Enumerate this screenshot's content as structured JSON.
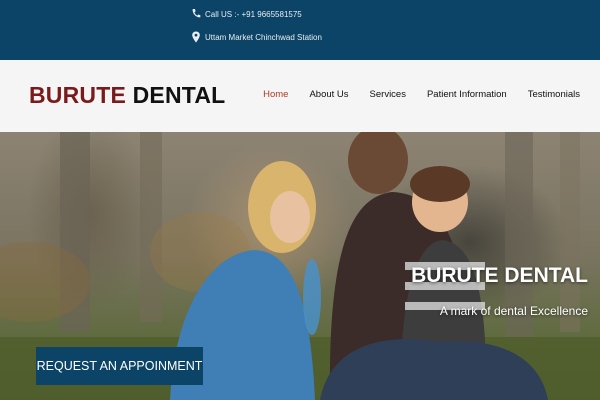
{
  "topbar": {
    "phone_text": "Call US :- +91 9665581575",
    "address_text": "Uttam Market Chinchwad Station",
    "phone_icon": "phone-icon",
    "location_icon": "map-pin-icon"
  },
  "header": {
    "logo_part1": "BURUTE",
    "logo_part2": "DENTAL",
    "nav": [
      {
        "label": "Home",
        "active": true
      },
      {
        "label": "About Us"
      },
      {
        "label": "Services"
      },
      {
        "label": "Patient Information"
      },
      {
        "label": "Testimonials"
      }
    ]
  },
  "hero": {
    "title": "BURUTE DENTAL",
    "subtitle": "A mark of dental Excellence",
    "cta_label": "REQUEST AN APPOINMENT"
  },
  "colors": {
    "topbar_bg": "#0b4466",
    "nav_active": "#b03a26",
    "logo_accent": "#7a1a1a"
  }
}
